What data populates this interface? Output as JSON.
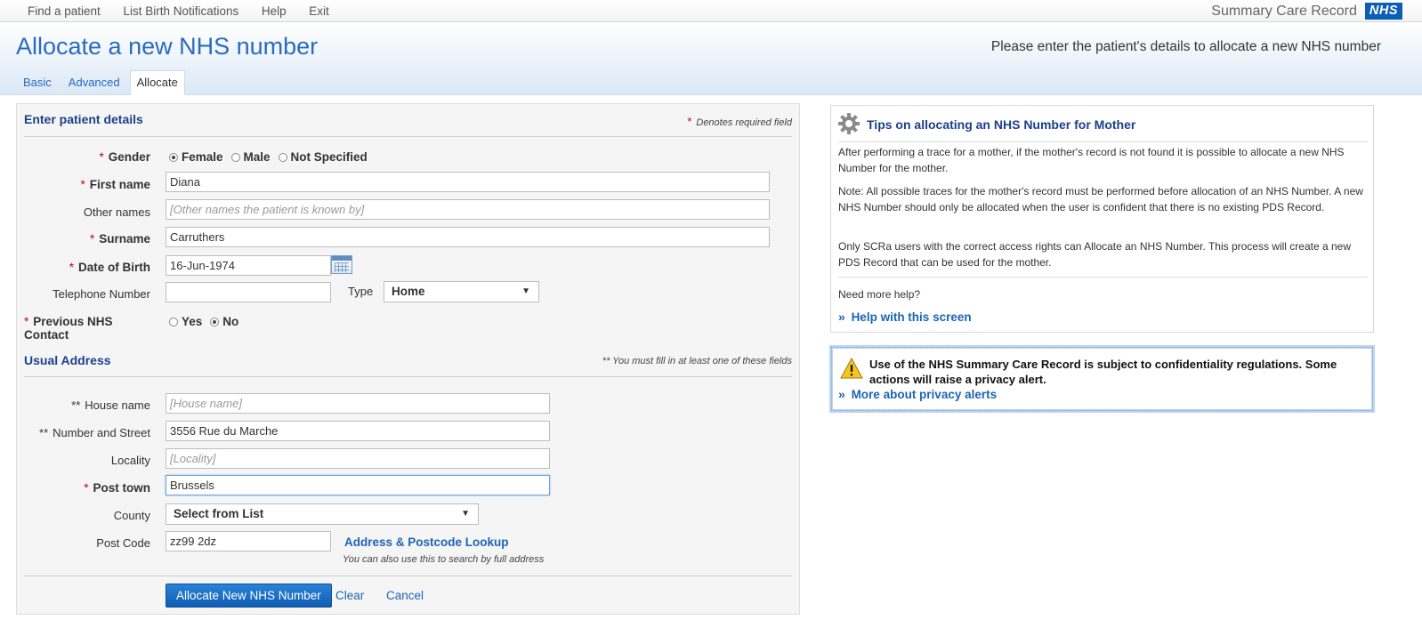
{
  "menu": {
    "items": [
      "Find a patient",
      "List Birth Notifications",
      "Help",
      "Exit"
    ],
    "brand": "Summary Care Record",
    "logo": "NHS"
  },
  "header": {
    "title": "Allocate a new NHS number",
    "hint": "Please enter the patient's details to allocate a new NHS number",
    "tabs": [
      "Basic",
      "Advanced",
      "Allocate"
    ],
    "active_tab": "Allocate"
  },
  "patient": {
    "section_title": "Enter patient details",
    "required_note": "Denotes required field",
    "gender": {
      "label": "Gender",
      "options": [
        "Female",
        "Male",
        "Not Specified"
      ],
      "selected": "Female"
    },
    "first_name": {
      "label": "First name",
      "value": "Diana"
    },
    "other_names": {
      "label": "Other names",
      "placeholder": "[Other names the patient is known by]"
    },
    "surname": {
      "label": "Surname",
      "value": "Carruthers"
    },
    "dob": {
      "label": "Date of Birth",
      "value": "16-Jun-1974"
    },
    "telephone": {
      "label": "Telephone Number",
      "value": "",
      "type_label": "Type",
      "type_value": "Home"
    },
    "prev_contact": {
      "label": "Previous NHS Contact",
      "options": [
        "Yes",
        "No"
      ],
      "selected": "No"
    }
  },
  "address": {
    "section_title": "Usual Address",
    "note": "** You must fill in at least one of these fields",
    "house_name": {
      "label": "House name",
      "placeholder": "[House name]"
    },
    "street": {
      "label": "Number and Street",
      "value": "3556 Rue du Marche"
    },
    "locality": {
      "label": "Locality",
      "placeholder": "[Locality]"
    },
    "post_town": {
      "label": "Post town",
      "value": "Brussels"
    },
    "county": {
      "label": "County",
      "value": "Select from List"
    },
    "post_code": {
      "label": "Post Code",
      "value": "zz99 2dz"
    },
    "lookup_link": "Address & Postcode Lookup",
    "lookup_note": "You can also use this to search by full address"
  },
  "actions": {
    "allocate": "Allocate New NHS Number",
    "clear": "Clear",
    "cancel": "Cancel"
  },
  "tips": {
    "title": "Tips on allocating an NHS Number for Mother",
    "p1": "After performing a trace for a mother, if the mother's record is not found it is possible to allocate a new NHS Number for the mother.",
    "p2": "Note: All possible traces for the mother's record must be performed before allocation of an NHS Number. A new NHS Number should only be allocated when the user is confident that there is no existing PDS Record.",
    "p3": "Only SCRa users with the correct access rights can Allocate an NHS Number. This process will create a new PDS Record that can be used for the mother.",
    "more_help": "Need more help?",
    "help_link": "Help with this screen"
  },
  "privacy": {
    "text": "Use of the NHS Summary Care Record is subject to confidentiality regulations. Some actions will raise a privacy alert.",
    "link": "More about privacy alerts"
  },
  "colors": {
    "title_blue": "#2a6bbd",
    "section_navy": "#1b3f8b",
    "required_red": "#cc0000",
    "button_blue": "#0f5db3",
    "nhs_blue": "#0a5eb4"
  }
}
